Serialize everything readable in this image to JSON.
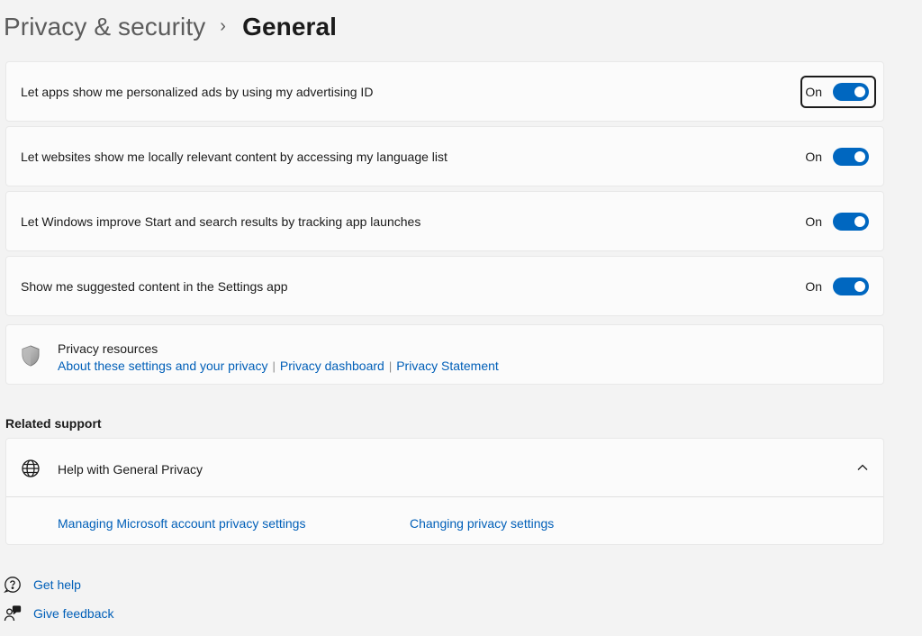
{
  "breadcrumb": {
    "parent": "Privacy & security",
    "separator": "›",
    "current": "General"
  },
  "settings": [
    {
      "label": "Let apps show me personalized ads by using my advertising ID",
      "state": "On",
      "on": true,
      "focused": true
    },
    {
      "label": "Let websites show me locally relevant content by accessing my language list",
      "state": "On",
      "on": true,
      "focused": false
    },
    {
      "label": "Let Windows improve Start and search results by tracking app launches",
      "state": "On",
      "on": true,
      "focused": false
    },
    {
      "label": "Show me suggested content in the Settings app",
      "state": "On",
      "on": true,
      "focused": false
    }
  ],
  "privacy_resources": {
    "title": "Privacy resources",
    "icon": "shield-icon",
    "links": [
      "About these settings and your privacy",
      "Privacy dashboard",
      "Privacy Statement"
    ],
    "separator": "|"
  },
  "related_support": {
    "heading": "Related support",
    "help": {
      "icon": "globe-icon",
      "title": "Help with General Privacy",
      "expanded": true,
      "links": [
        "Managing Microsoft account privacy settings",
        "Changing privacy settings"
      ]
    }
  },
  "footer": {
    "get_help": "Get help",
    "give_feedback": "Give feedback"
  },
  "colors": {
    "accent": "#0067c0",
    "link": "#005fb8",
    "background": "#f3f3f3",
    "card": "#fbfbfb"
  }
}
